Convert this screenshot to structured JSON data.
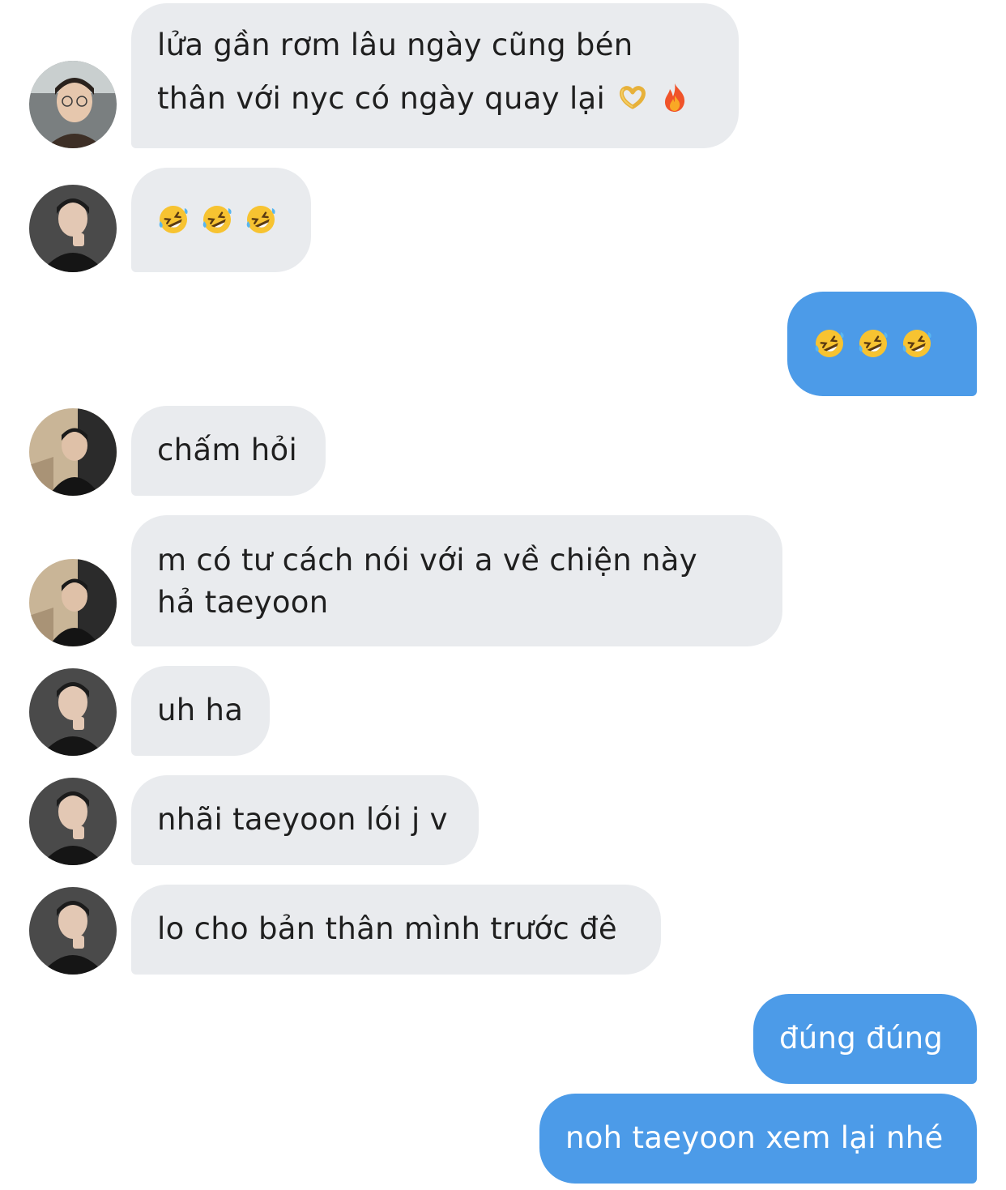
{
  "conversation": {
    "messages": [
      {
        "sender": "friend-glasses",
        "lines": [
          "lửa gần rơm lâu ngày cũng bén",
          "thân với nyc có ngày quay lại"
        ],
        "emojis": [
          "heart-hands-emoji",
          "fire-emoji"
        ]
      },
      {
        "sender": "friend-black-jacket",
        "emojis": [
          "rolling-laughing-emoji",
          "rolling-laughing-emoji",
          "rolling-laughing-emoji"
        ]
      },
      {
        "sender": "me",
        "emojis": [
          "rolling-laughing-emoji",
          "rolling-laughing-emoji",
          "rolling-laughing-emoji"
        ]
      },
      {
        "sender": "friend-stairs",
        "lines": [
          "chấm hỏi"
        ]
      },
      {
        "sender": "friend-stairs",
        "lines": [
          "m có tư cách nói với a về chiện này",
          "hả taeyoon"
        ]
      },
      {
        "sender": "friend-black-jacket",
        "lines": [
          "uh ha"
        ]
      },
      {
        "sender": "friend-black-jacket",
        "lines": [
          "nhãi taeyoon lói j v"
        ]
      },
      {
        "sender": "friend-black-jacket",
        "lines": [
          "lo cho bản thân mình trước đê"
        ]
      },
      {
        "sender": "me",
        "lines": [
          "đúng đúng"
        ]
      },
      {
        "sender": "me",
        "lines": [
          "noh taeyoon xem lại nhé"
        ]
      }
    ]
  },
  "colors": {
    "incoming_bubble": "#e9ebee",
    "outgoing_bubble": "#4c9be8",
    "incoming_text": "#1f1f1f",
    "outgoing_text": "#ffffff"
  }
}
